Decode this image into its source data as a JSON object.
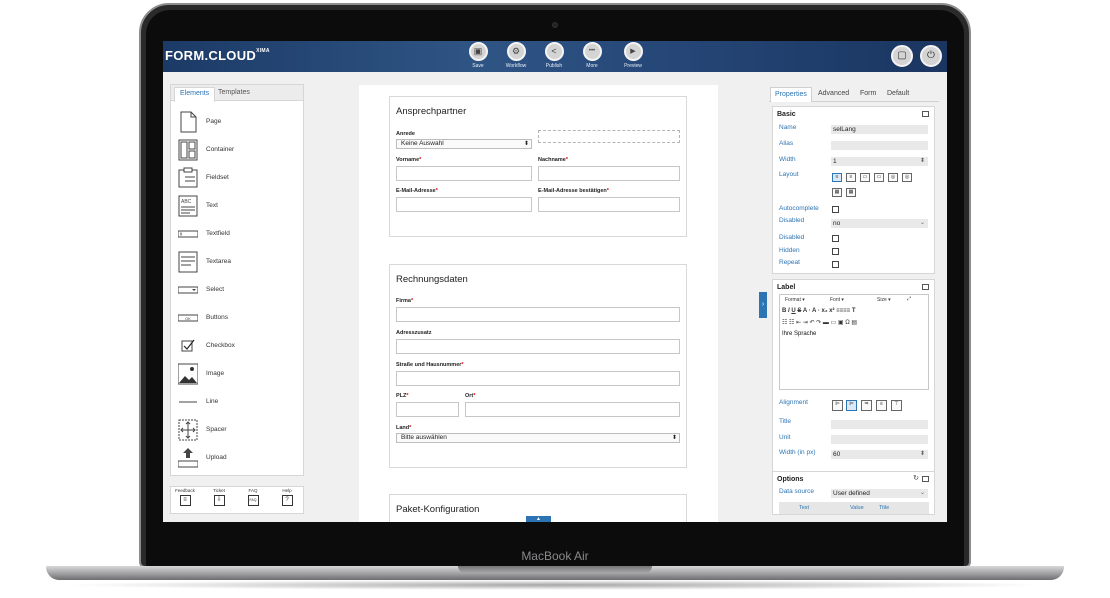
{
  "device": {
    "label": "MacBook Air"
  },
  "app": {
    "brand": "FORM.CLOUD",
    "brand_sup": "XIMA"
  },
  "toolbar": {
    "items": [
      {
        "label": "Save",
        "icon": "save-icon",
        "glyph": "▣"
      },
      {
        "label": "Workflow",
        "icon": "workflow-icon",
        "glyph": "⚙"
      },
      {
        "label": "Publish",
        "icon": "share-icon",
        "glyph": "<"
      },
      {
        "label": "More",
        "icon": "more-icon",
        "glyph": "•••"
      },
      {
        "label": "Preview",
        "icon": "play-icon",
        "glyph": "▶"
      }
    ],
    "right": [
      {
        "icon": "chat-icon",
        "glyph": "▢"
      },
      {
        "icon": "power-icon",
        "glyph": "⏻"
      }
    ]
  },
  "left_panel": {
    "tabs": [
      "Elements",
      "Templates"
    ],
    "active_tab": "Elements",
    "elements": [
      "Page",
      "Container",
      "Fieldset",
      "Text",
      "Textfield",
      "Textarea",
      "Select",
      "Buttons",
      "Checkbox",
      "Image",
      "Line",
      "Spacer",
      "Upload"
    ],
    "help": [
      "Feedback",
      "Ticket",
      "FAQ",
      "Help"
    ]
  },
  "form": {
    "section1": {
      "title": "Ansprechpartner",
      "anrede_label": "Anrede",
      "anrede_value": "Keine Auswahl",
      "vorname_label": "Vorname",
      "nachname_label": "Nachname",
      "email_label": "E-Mail-Adresse",
      "email_confirm_label": "E-Mail-Adresse bestätigen"
    },
    "section2": {
      "title": "Rechnungsdaten",
      "firma_label": "Firma",
      "adresszusatz_label": "Adresszusatz",
      "strasse_label": "Straße und Hausnummer",
      "plz_label": "PLZ",
      "ort_label": "Ort",
      "land_label": "Land",
      "land_value": "Bitte auswählen"
    },
    "section3": {
      "title": "Paket-Konfiguration"
    },
    "required_mark": "*"
  },
  "right_panel": {
    "tabs": [
      "Properties",
      "Advanced",
      "Form",
      "Default"
    ],
    "active_tab": "Properties",
    "basic": {
      "title": "Basic",
      "name_label": "Name",
      "name_value": "selLang",
      "alias_label": "Alias",
      "alias_value": "",
      "width_label": "Width",
      "width_value": "1",
      "layout_label": "Layout",
      "autocomplete_label": "Autocomplete",
      "disabled_label": "Disabled",
      "disabled_value": "no",
      "disabled2_label": "Disabled",
      "hidden_label": "Hidden",
      "repeat_label": "Repeat"
    },
    "label": {
      "title": "Label",
      "format_label": "Format",
      "font_label": "Font",
      "size_label": "Size",
      "editor_text": "Ihre Sprache",
      "alignment_label": "Alignment",
      "title_label": "Title",
      "unit_label": "Unit",
      "width_px_label": "Width (in px)",
      "width_px_value": "60"
    },
    "options": {
      "title": "Options",
      "data_source_label": "Data source",
      "data_source_value": "User defined",
      "columns": [
        "Text",
        "Value",
        "Title"
      ]
    }
  },
  "colors": {
    "accent": "#2c74b3",
    "topbar": "#24467a",
    "required": "#dd0000"
  }
}
